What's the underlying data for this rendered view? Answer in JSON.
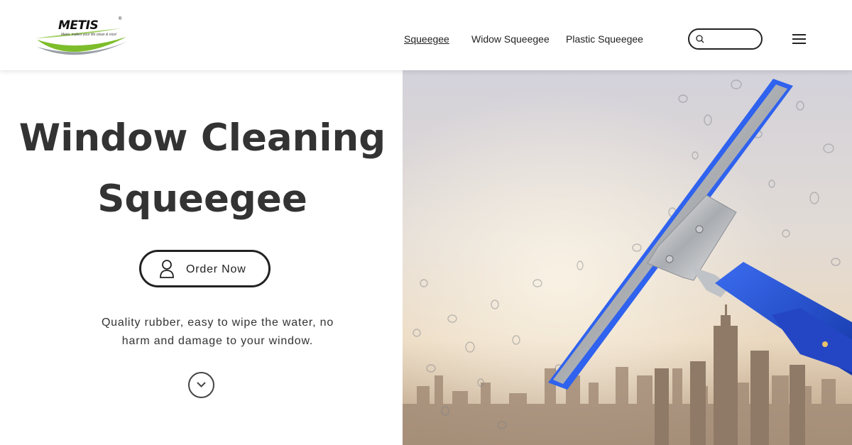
{
  "header": {
    "logo": {
      "name": "METIS",
      "tagline": "Metis, makes your life clean & nice!",
      "trademark": "®",
      "colors": {
        "green": "#7dbd2b",
        "grey": "#9aa0a6"
      }
    },
    "nav": [
      {
        "label": "Squeegee",
        "active": true
      },
      {
        "label": "Widow Squeegee",
        "active": false
      },
      {
        "label": "Plastic Squeegee",
        "active": false
      }
    ],
    "search": {
      "placeholder": "",
      "icon": "search-icon"
    },
    "menu_icon": "hamburger-menu-icon"
  },
  "hero": {
    "title_line1": "Window Cleaning",
    "title_line2": "Squeegee",
    "order_button": {
      "label": "Order Now",
      "icon": "user-icon"
    },
    "description_line1": "Quality rubber, easy to wipe the water, no",
    "description_line2": "harm and damage to your window.",
    "scroll_icon": "chevron-down-icon"
  },
  "image": {
    "subject": "window-squeegee-photo",
    "colors": {
      "handle": "#1f4fd6",
      "blade": "#3366ee",
      "sky": "#d9d7de",
      "city": "#b39a80"
    }
  }
}
